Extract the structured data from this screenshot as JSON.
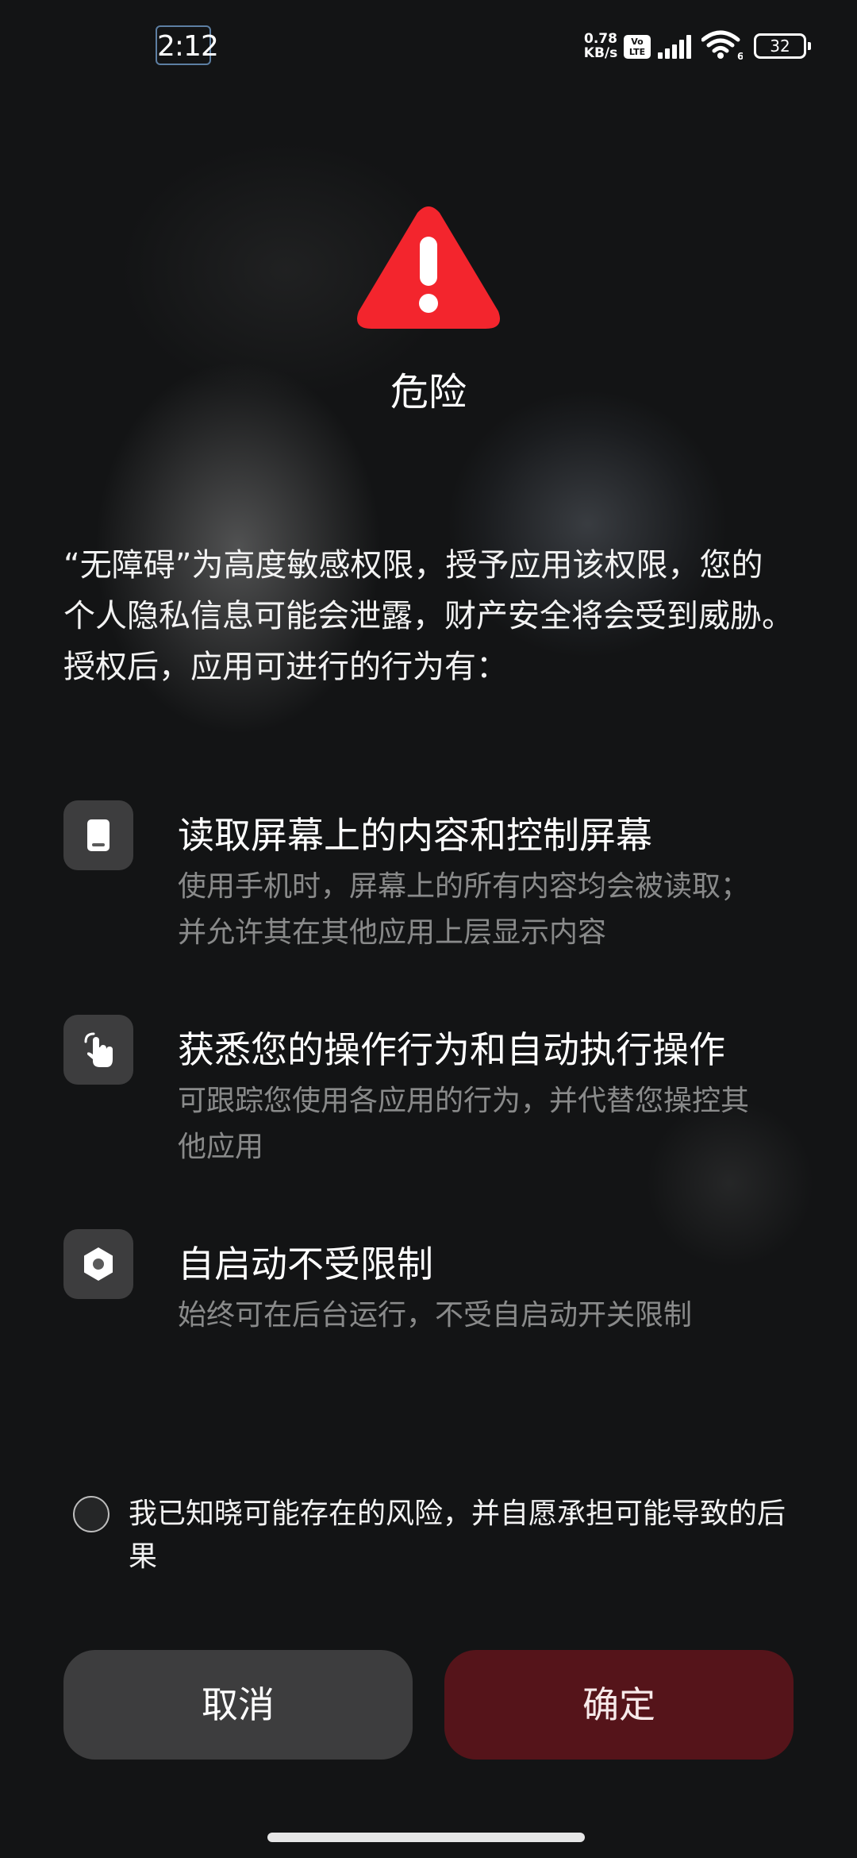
{
  "status_bar": {
    "time": "2:12",
    "net_speed_value": "0.78",
    "net_speed_unit": "KB/s",
    "volte_top": "Vo",
    "volte_bottom": "LTE",
    "wifi_badge": "6",
    "battery_level": "32"
  },
  "dialog": {
    "icon": "warning-triangle-icon",
    "title": "危险",
    "description": "“无障碍”为高度敏感权限，授予应用该权限，您的个人隐私信息可能会泄露，财产安全将会受到威胁。授权后，应用可进行的行为有："
  },
  "permissions": [
    {
      "icon": "phone-screen-icon",
      "title": "读取屏幕上的内容和控制屏幕",
      "description": "使用手机时，屏幕上的所有内容均会被读取；并允许其在其他应用上层显示内容"
    },
    {
      "icon": "touch-hand-icon",
      "title": "获悉您的操作行为和自动执行操作",
      "description": "可跟踪您使用各应用的行为，并代替您操控其他应用"
    },
    {
      "icon": "hexagon-icon",
      "title": "自启动不受限制",
      "description": "始终可在后台运行，不受自启动开关限制"
    }
  ],
  "consent": {
    "checked": false,
    "text": "我已知晓可能存在的风险，并自愿承担可能导致的后果"
  },
  "buttons": {
    "cancel": "取消",
    "confirm": "确定"
  },
  "colors": {
    "warning_red": "#F3252D",
    "confirm_bg": "#55141A",
    "cancel_bg": "#3D3D3E",
    "background": "#131415"
  }
}
